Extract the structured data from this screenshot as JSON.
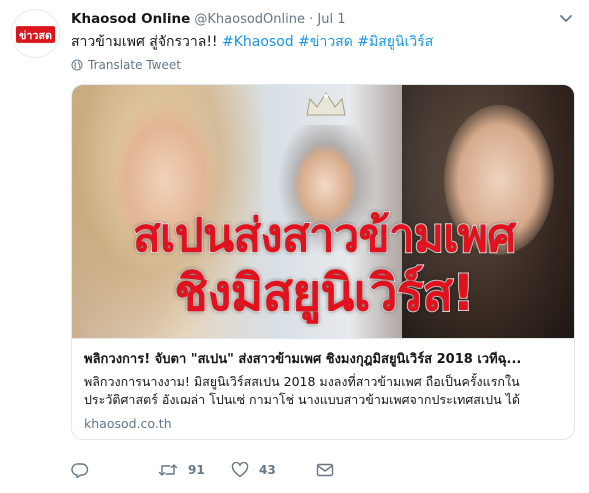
{
  "tweet": {
    "author_name": "Khaosod Online",
    "handle": "@KhaosodOnline",
    "separator": "·",
    "time": "Jul 1",
    "avatar_logo_text": "ข่าวสด",
    "text_plain": "สาวข้ามเพศ สู่จักรวาล!!",
    "hashtags": [
      "#Khaosod",
      "#ข่าวสด",
      "#มิสยูนิเวิร์ส"
    ],
    "translate_label": "Translate Tweet"
  },
  "card": {
    "image_headline_1": "สเปนส่งสาวข้ามเพศ",
    "image_headline_2": "ชิงมิสยูนิเวิร์ส!",
    "title": "พลิกวงการ! จับตา \"สเปน\" ส่งสาวข้ามเพศ ชิงมงกุฎมิสยูนิเวิร์ส 2018 เวทีฉุ...",
    "description": "พลิกวงการนางงาม! มิสยูนิเวิร์สสเปน 2018 มงลงที่สาวข้ามเพศ ถือเป็นครั้งแรกใน ประวัติศาสตร์ อังเฌล่า โปนเซ่ กามาโช่ นางแบบสาวข้ามเพศจากประเทศสเปน ได้",
    "domain": "khaosod.co.th"
  },
  "actions": {
    "reply_icon": "reply-icon",
    "retweet_icon": "retweet-icon",
    "retweet_count": "91",
    "like_icon": "heart-icon",
    "like_count": "43",
    "dm_icon": "envelope-icon"
  },
  "colors": {
    "link": "#1b95e0",
    "secondary_text": "#657786",
    "headline_red": "#e1121d",
    "logo_red": "#d9151d"
  }
}
